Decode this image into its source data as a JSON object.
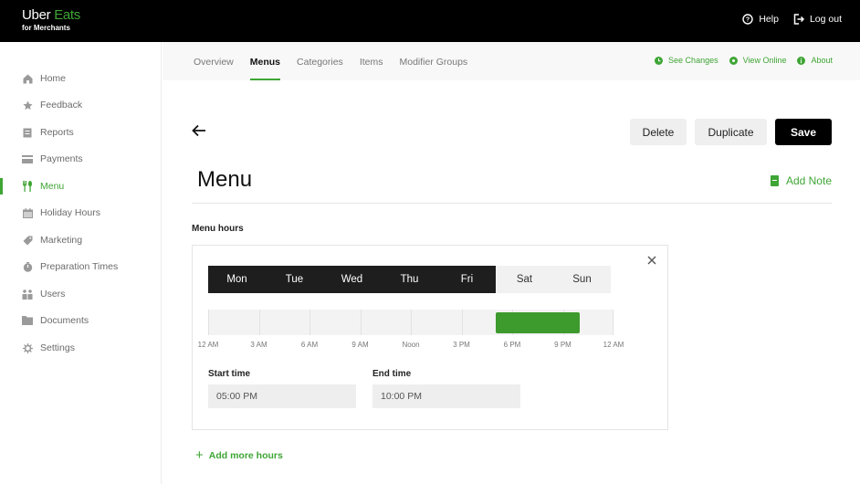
{
  "header": {
    "logo_primary": "Uber",
    "logo_accent": "Eats",
    "logo_sub": "for Merchants",
    "help_label": "Help",
    "logout_label": "Log out"
  },
  "sidebar": {
    "items": [
      {
        "label": "Home",
        "icon": "home-icon",
        "active": false
      },
      {
        "label": "Feedback",
        "icon": "star-icon",
        "active": false
      },
      {
        "label": "Reports",
        "icon": "report-icon",
        "active": false
      },
      {
        "label": "Payments",
        "icon": "card-icon",
        "active": false
      },
      {
        "label": "Menu",
        "icon": "utensils-icon",
        "active": true
      },
      {
        "label": "Holiday Hours",
        "icon": "calendar-icon",
        "active": false
      },
      {
        "label": "Marketing",
        "icon": "tag-icon",
        "active": false
      },
      {
        "label": "Preparation Times",
        "icon": "timer-icon",
        "active": false
      },
      {
        "label": "Users",
        "icon": "users-icon",
        "active": false
      },
      {
        "label": "Documents",
        "icon": "folder-icon",
        "active": false
      },
      {
        "label": "Settings",
        "icon": "gear-icon",
        "active": false
      }
    ]
  },
  "subnav": {
    "tabs": [
      {
        "label": "Overview",
        "active": false
      },
      {
        "label": "Menus",
        "active": true
      },
      {
        "label": "Categories",
        "active": false
      },
      {
        "label": "Items",
        "active": false
      },
      {
        "label": "Modifier Groups",
        "active": false
      }
    ],
    "links": [
      {
        "label": "See Changes",
        "icon": "clock-icon"
      },
      {
        "label": "View Online",
        "icon": "eye-icon"
      },
      {
        "label": "About",
        "icon": "info-icon"
      }
    ]
  },
  "toolbar": {
    "delete_label": "Delete",
    "duplicate_label": "Duplicate",
    "save_label": "Save"
  },
  "page": {
    "title": "Menu",
    "add_note_label": "Add Note",
    "section_label": "Menu hours",
    "add_more_label": "Add more hours"
  },
  "hours": {
    "days": [
      {
        "label": "Mon",
        "selected": true
      },
      {
        "label": "Tue",
        "selected": true
      },
      {
        "label": "Wed",
        "selected": true
      },
      {
        "label": "Thu",
        "selected": true
      },
      {
        "label": "Fri",
        "selected": true
      },
      {
        "label": "Sat",
        "selected": false
      },
      {
        "label": "Sun",
        "selected": false
      }
    ],
    "timeline_ticks": [
      "12 AM",
      "3 AM",
      "6 AM",
      "9 AM",
      "Noon",
      "3 PM",
      "6 PM",
      "9 PM",
      "12 AM"
    ],
    "range_start_hour": 17,
    "range_end_hour": 22,
    "start_label": "Start time",
    "start_value": "05:00 PM",
    "end_label": "End time",
    "end_value": "10:00 PM"
  },
  "colors": {
    "brand_green": "#3fa535",
    "range_green": "#3d9a2d",
    "selected_day": "#1e1e1e"
  }
}
